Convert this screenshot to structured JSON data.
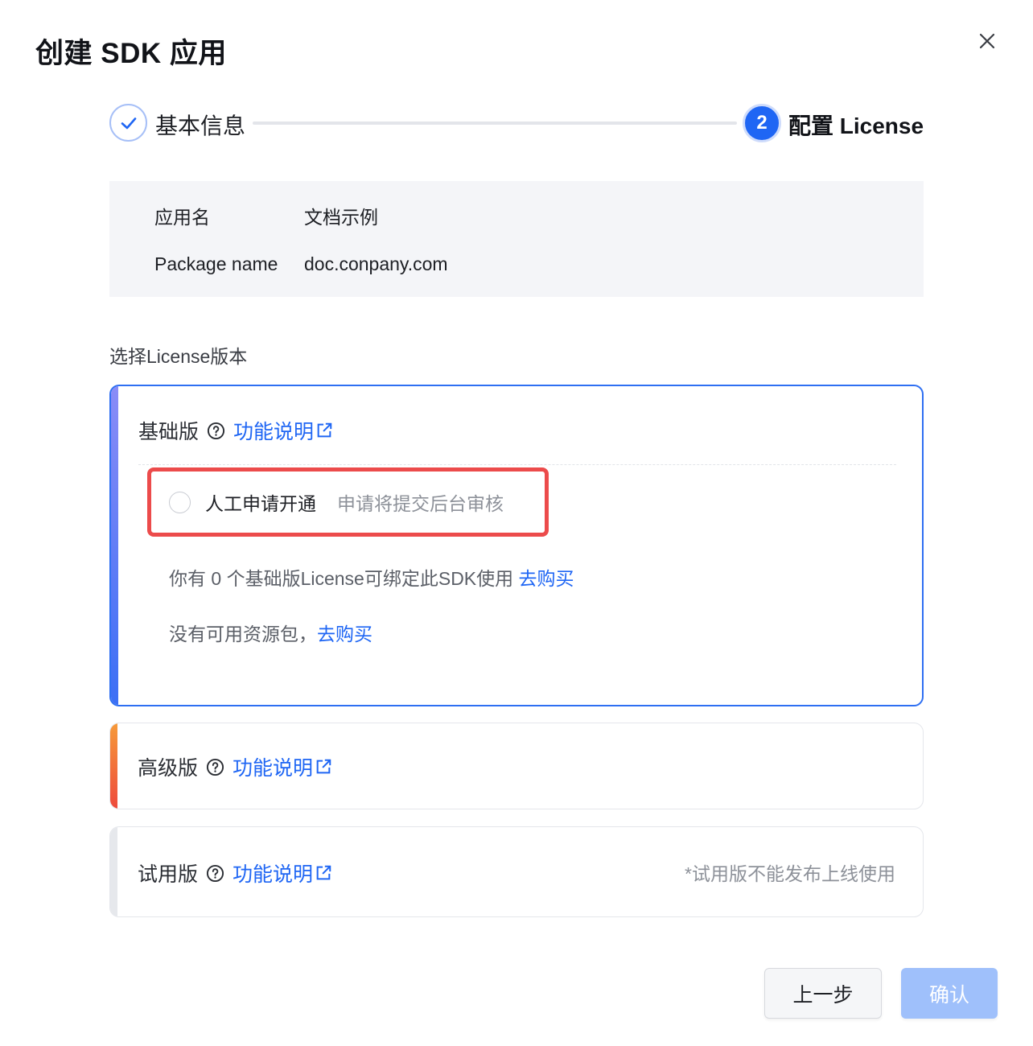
{
  "dialog": {
    "title": "创建 SDK 应用",
    "close_icon": "close-icon"
  },
  "steps": [
    {
      "label": "基本信息",
      "state": "completed",
      "icon": "check-icon"
    },
    {
      "number": "2",
      "label": "配置 License",
      "state": "active"
    }
  ],
  "app_info": {
    "rows": [
      {
        "key": "应用名",
        "value": "文档示例"
      },
      {
        "key": "Package name",
        "value": "doc.conpany.com"
      }
    ]
  },
  "license_section": {
    "label": "选择License版本",
    "basic": {
      "name": "基础版",
      "feature_link": "功能说明",
      "stripe_color": "#3b6ff5",
      "option": {
        "label": "人工申请开通",
        "hint": "申请将提交后台审核",
        "checked": false
      },
      "note1_prefix": "你有 0 个基础版License可绑定此SDK使用",
      "note1_link": "去购买",
      "note2_prefix": "没有可用资源包，",
      "note2_link": "去购买"
    },
    "advanced": {
      "name": "高级版",
      "feature_link": "功能说明",
      "stripe_color": "#ee4a3c"
    },
    "trial": {
      "name": "试用版",
      "feature_link": "功能说明",
      "note": "*试用版不能发布上线使用"
    }
  },
  "footer": {
    "prev_label": "上一步",
    "confirm_label": "确认"
  },
  "colors": {
    "primary": "#1f66f4",
    "highlight_border": "#ec4b4b",
    "confirm_disabled": "#9fc0fb"
  }
}
